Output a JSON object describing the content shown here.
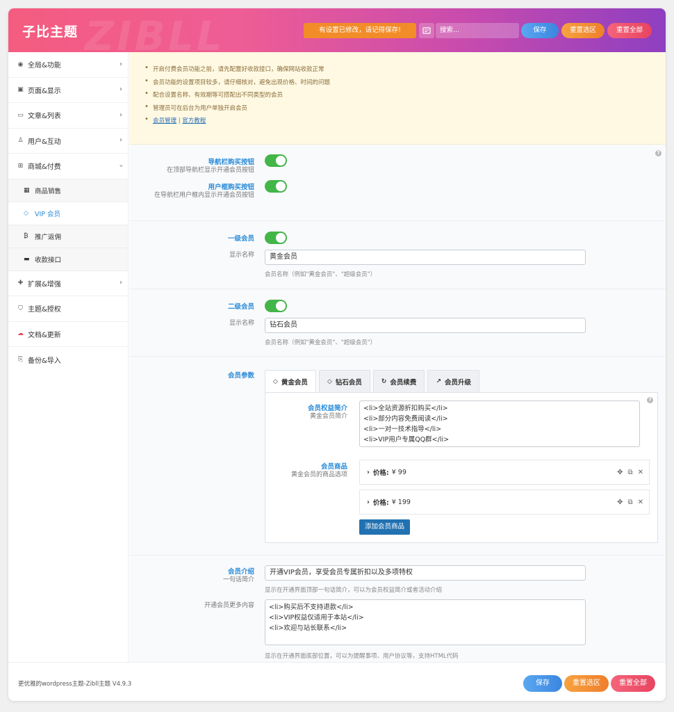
{
  "header": {
    "logo": "子比主题",
    "watermark": "ZIBLL",
    "notice": "有设置已修改，请记得保存!",
    "search_placeholder": "搜索...",
    "save": "保存",
    "reset_section": "重置选区",
    "reset_all": "重置全部"
  },
  "sidebar": {
    "items": [
      {
        "label": "全局&功能"
      },
      {
        "label": "页面&显示"
      },
      {
        "label": "文章&列表"
      },
      {
        "label": "用户&互动"
      },
      {
        "label": "商城&付费"
      },
      {
        "label": "扩展&增强"
      },
      {
        "label": "主题&授权"
      },
      {
        "label": "文档&更新"
      },
      {
        "label": "备份&导入"
      }
    ],
    "sub": [
      {
        "label": "商品销售"
      },
      {
        "label": "VIP 会员"
      },
      {
        "label": "推广返佣"
      },
      {
        "label": "收款接口"
      }
    ]
  },
  "notice": {
    "lines": [
      "开启付费会员功能之前，请先配置好收款接口，确保网站收款正常",
      "会员功能的设置项目较多，请仔细核对，避免出现价格、时间的问题",
      "配合设置名称、有效期等可搭配出不同类型的会员",
      "管理员可在后台为用户单独开启会员"
    ],
    "link1": "会员管理",
    "sep": "|",
    "link2": "官方教程"
  },
  "buy": {
    "nav_label": "导航栏购买按钮",
    "nav_desc": "在顶部导航栏显示开通会员按钮",
    "user_label": "用户框购买按钮",
    "user_desc": "在导航栏用户框内显示开通会员按钮"
  },
  "level1": {
    "label": "一级会员",
    "name_label": "显示名称",
    "value": "黄金会员",
    "hint": "会员名称（例如\"黄金会员\"、\"超级会员\"）"
  },
  "level2": {
    "label": "二级会员",
    "name_label": "显示名称",
    "value": "钻石会员",
    "hint": "会员名称（例如\"黄金会员\"、\"超级会员\"）"
  },
  "params": {
    "label": "会员参数",
    "tabs": [
      "黄金会员",
      "钻石会员",
      "会员续费",
      "会员升级"
    ],
    "benefit_label": "会员权益简介",
    "benefit_desc": "黄金会员简介",
    "benefit_lines": [
      "<li>全站资源折扣购买</li>",
      "<li>部分内容免费阅读</li>",
      "<li>一对一技术指导</li>",
      "<li>VIP用户专属QQ群</li>"
    ],
    "product_label": "会员商品",
    "product_desc": "黄金会员的商品选项",
    "price_key": "价格:",
    "products": [
      "¥ 99",
      "¥ 199"
    ],
    "add_button": "添加会员商品"
  },
  "intro": {
    "label": "会员介绍",
    "desc": "一句话简介",
    "value": "开通VIP会员，享受会员专属折扣以及多项特权",
    "hint": "显示在开通界面顶部一句话简介，可以为会员权益简介或者活动介绍",
    "more_label": "开通会员更多内容",
    "more_lines": [
      "<li>购买后不支持退款</li>",
      "<li>VIP权益仅适用于本站</li>",
      "<li>欢迎与站长联系</li>"
    ],
    "more_hint": "显示在开通界面底部位置，可以为提醒事项、用户协议等，支持HTML代码"
  },
  "footer": {
    "version": "更优雅的wordpress主题-Zibll主题 V4.9.3",
    "save": "保存",
    "reset_section": "重置选区",
    "reset_all": "重置全部"
  },
  "colors": {
    "accent": "#2a8cd8",
    "toggle_on": "#44b549",
    "primary_button": "#2271b1"
  }
}
